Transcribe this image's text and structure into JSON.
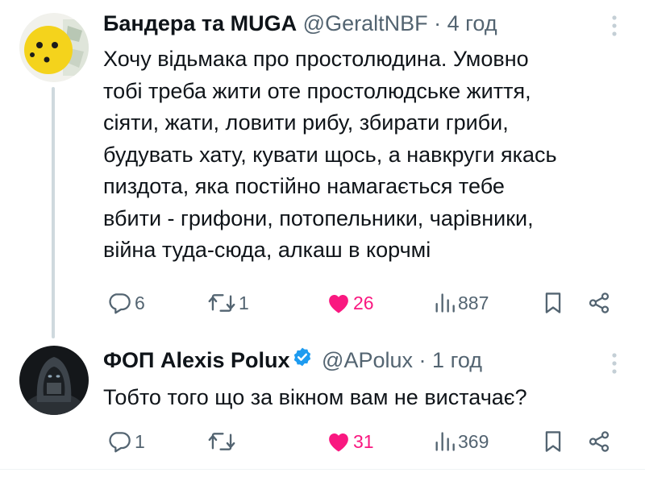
{
  "tweets": [
    {
      "author": {
        "display_name": "Бандера та MUGA",
        "handle": "@GeraltNBF",
        "avatar_icon": "yellow-smiley-avatar"
      },
      "separator": "·",
      "time": "4 год",
      "lines": [
        "Хочу відьмака про простолюдина. Умовно",
        "тобі треба жити оте простолюдське життя,",
        "сіяти, жати, ловити рибу, збирати гриби,",
        "будувать хату, кувати щось, а навкруги якась",
        "пиздота, яка постійно намагається тебе",
        "вбити - грифони, потопельники, чарівники,",
        "війна туда-сюда, алкаш в корчмі"
      ],
      "replies": "6",
      "retweets": "1",
      "likes": "26",
      "liked": true,
      "views": "887"
    },
    {
      "author": {
        "display_name": "ФОП Alexis Polux",
        "handle": "@APolux",
        "verified": true,
        "avatar_icon": "dark-hooded-figure-avatar"
      },
      "separator": "·",
      "time": "1 год",
      "lines": [
        "Тобто того що за вікном вам не вистачає?"
      ],
      "replies": "1",
      "retweets": "",
      "likes": "31",
      "liked": true,
      "views": "369"
    }
  ],
  "colors": {
    "text": "#0f1419",
    "secondary": "#536471",
    "like": "#f91880",
    "verified": "#1d9bf0",
    "thread_line": "#cfd9de"
  }
}
